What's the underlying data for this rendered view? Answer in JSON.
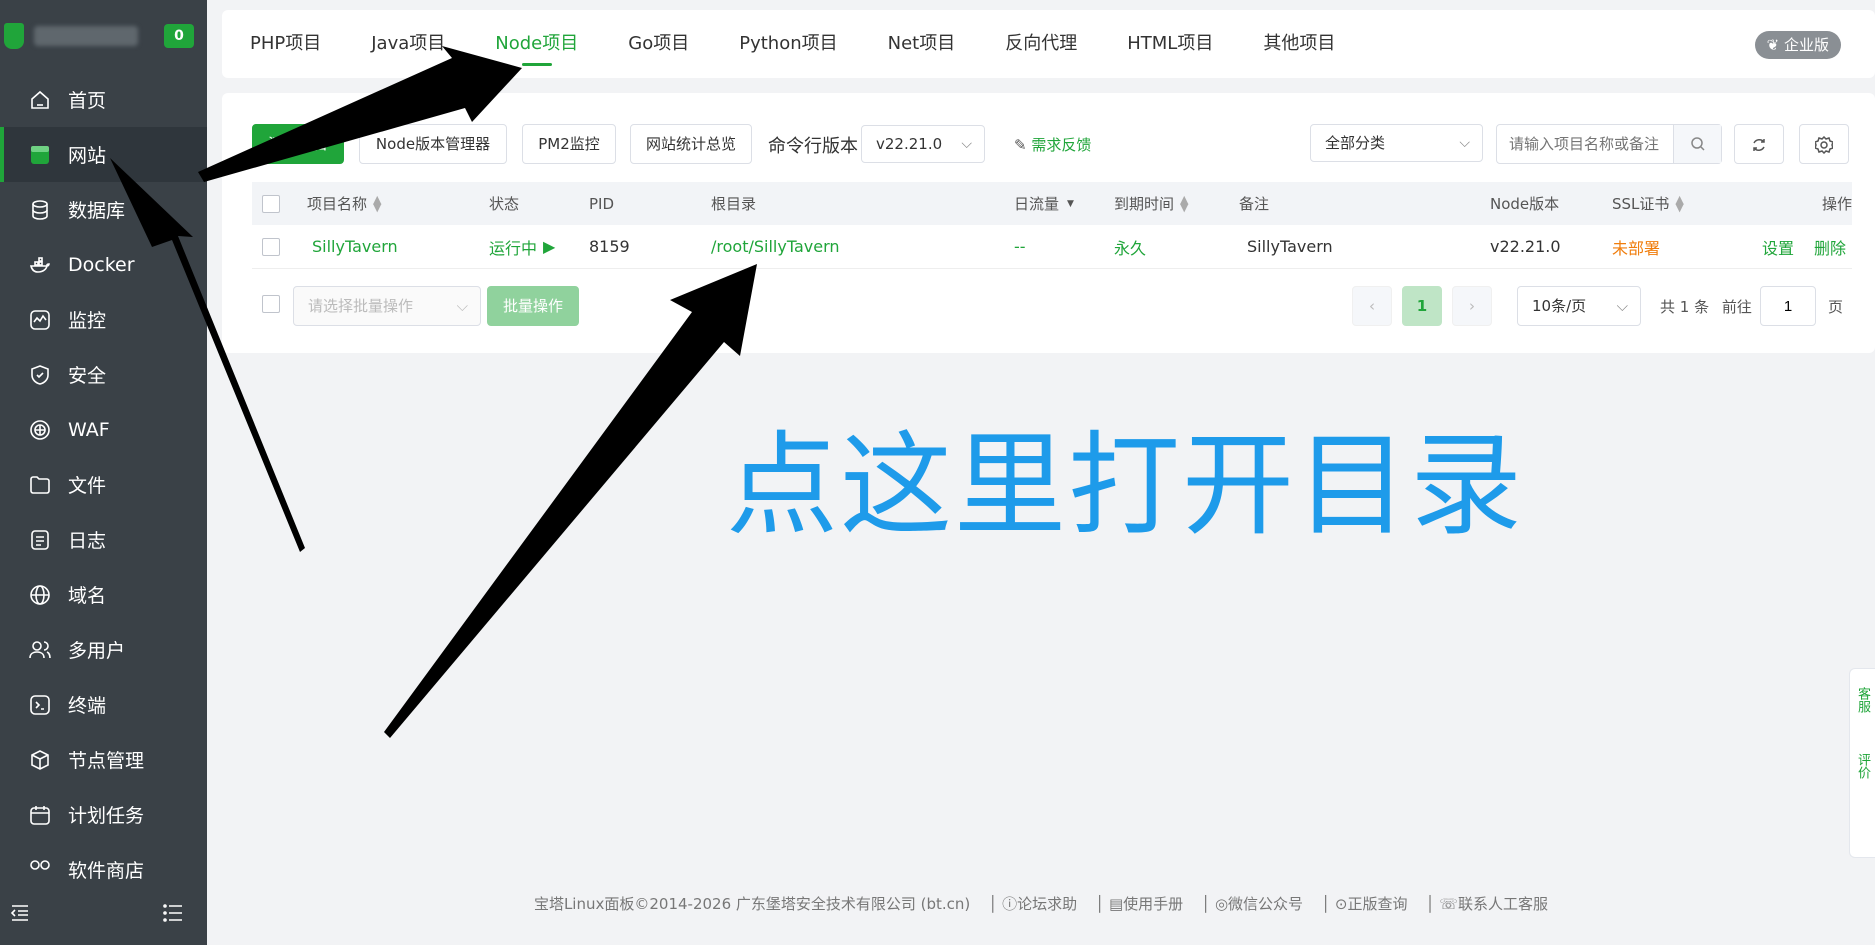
{
  "sidebar": {
    "badge_count": "0",
    "items": [
      {
        "label": "首页",
        "icon": "home-icon"
      },
      {
        "label": "网站",
        "icon": "website-icon",
        "active": true
      },
      {
        "label": "数据库",
        "icon": "database-icon"
      },
      {
        "label": "Docker",
        "icon": "docker-icon"
      },
      {
        "label": "监控",
        "icon": "monitor-icon"
      },
      {
        "label": "安全",
        "icon": "shield-icon"
      },
      {
        "label": "WAF",
        "icon": "waf-icon"
      },
      {
        "label": "文件",
        "icon": "folder-icon"
      },
      {
        "label": "日志",
        "icon": "log-icon"
      },
      {
        "label": "域名",
        "icon": "globe-icon"
      },
      {
        "label": "多用户",
        "icon": "users-icon"
      },
      {
        "label": "终端",
        "icon": "terminal-icon"
      },
      {
        "label": "节点管理",
        "icon": "cube-icon"
      },
      {
        "label": "计划任务",
        "icon": "calendar-icon"
      },
      {
        "label": "软件商店",
        "icon": "store-icon"
      }
    ]
  },
  "tabs": [
    "PHP项目",
    "Java项目",
    "Node项目",
    "Go项目",
    "Python项目",
    "Net项目",
    "反向代理",
    "HTML项目",
    "其他项目"
  ],
  "active_tab": "Node项目",
  "enterprise_label": "企业版",
  "toolbar": {
    "add_label": "添加项目",
    "node_version_mgr": "Node版本管理器",
    "pm2": "PM2监控",
    "site_stats": "网站统计总览",
    "cli_version_label": "命令行版本",
    "cli_version_value": "v22.21.0",
    "feedback": "需求反馈",
    "category_value": "全部分类",
    "search_placeholder": "请输入项目名称或备注"
  },
  "table": {
    "headers": {
      "name": "项目名称",
      "status": "状态",
      "pid": "PID",
      "root": "根目录",
      "traffic": "日流量",
      "expire": "到期时间",
      "remark": "备注",
      "node_version": "Node版本",
      "ssl": "SSL证书",
      "ops": "操作"
    },
    "rows": [
      {
        "name": "SillyTavern",
        "status": "运行中",
        "pid": "8159",
        "root": "/root/SillyTavern",
        "traffic": "--",
        "expire": "永久",
        "remark": "SillyTavern",
        "node_version": "v22.21.0",
        "ssl": "未部署",
        "op_settings": "设置",
        "op_delete": "删除"
      }
    ]
  },
  "bulk": {
    "select_placeholder": "请选择批量操作",
    "button": "批量操作"
  },
  "pagination": {
    "current": "1",
    "per_page": "10条/页",
    "total_prefix": "共",
    "total": "1",
    "total_suffix": "条",
    "goto_label": "前往",
    "goto_value": "1",
    "page_suffix": "页"
  },
  "annotation_text": "点这里打开目录",
  "float": {
    "service": "客服",
    "review": "评价"
  },
  "footer": {
    "copyright": "宝塔Linux面板©2014-2026 广东堡塔安全技术有限公司 (bt.cn)",
    "forum": "论坛求助",
    "manual": "使用手册",
    "wechat": "微信公众号",
    "license": "正版查询",
    "support": "联系人工客服"
  },
  "colors": {
    "brand_green": "#20a53a",
    "sidebar_bg": "#3a4147",
    "annotation_blue": "#1e9bea",
    "ssl_orange": "#f07d0c"
  }
}
